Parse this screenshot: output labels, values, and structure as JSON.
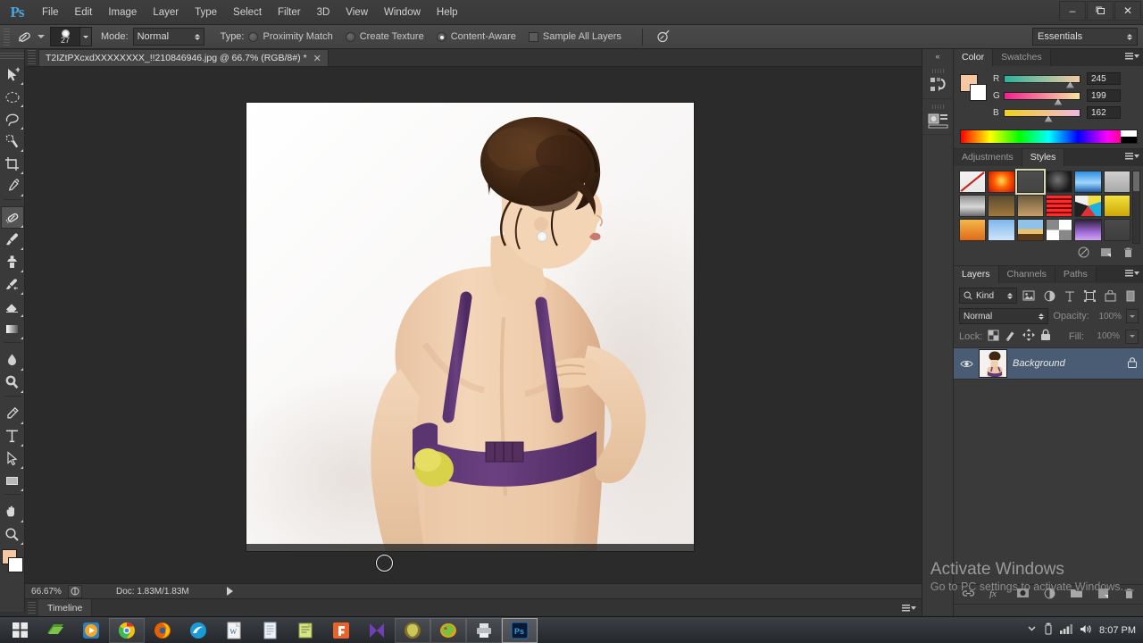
{
  "app": {
    "name": "Adobe Photoshop",
    "logo_text": "Ps",
    "workspace": "Essentials"
  },
  "menubar": {
    "items": [
      {
        "label": "File"
      },
      {
        "label": "Edit"
      },
      {
        "label": "Image"
      },
      {
        "label": "Layer"
      },
      {
        "label": "Type"
      },
      {
        "label": "Select"
      },
      {
        "label": "Filter"
      },
      {
        "label": "3D"
      },
      {
        "label": "View"
      },
      {
        "label": "Window"
      },
      {
        "label": "Help"
      }
    ],
    "window_controls": {
      "minimize": "–",
      "restore": "❐",
      "close": "✕"
    }
  },
  "options_bar": {
    "tool_icon": "spot-healing-brush-icon",
    "brush_size": "27",
    "mode_label": "Mode:",
    "mode_value": "Normal",
    "type_label": "Type:",
    "type_options": [
      {
        "label": "Proximity Match",
        "selected": false
      },
      {
        "label": "Create Texture",
        "selected": false
      },
      {
        "label": "Content-Aware",
        "selected": true
      }
    ],
    "sample_all_layers": {
      "label": "Sample All Layers",
      "checked": false
    },
    "pressure_icon": "tablet-pressure-icon"
  },
  "toolbar": {
    "tools": [
      {
        "name": "move-tool",
        "selected": false
      },
      {
        "name": "marquee-tool",
        "selected": false
      },
      {
        "name": "lasso-tool",
        "selected": false
      },
      {
        "name": "quick-selection-tool",
        "selected": false
      },
      {
        "name": "crop-tool",
        "selected": false
      },
      {
        "name": "eyedropper-tool",
        "selected": false
      },
      {
        "name": "spot-healing-brush-tool",
        "selected": true
      },
      {
        "name": "brush-tool",
        "selected": false
      },
      {
        "name": "clone-stamp-tool",
        "selected": false
      },
      {
        "name": "history-brush-tool",
        "selected": false
      },
      {
        "name": "eraser-tool",
        "selected": false
      },
      {
        "name": "gradient-tool",
        "selected": false
      },
      {
        "name": "blur-tool",
        "selected": false
      },
      {
        "name": "dodge-tool",
        "selected": false
      },
      {
        "name": "pen-tool",
        "selected": false
      },
      {
        "name": "type-tool",
        "selected": false
      },
      {
        "name": "path-selection-tool",
        "selected": false
      },
      {
        "name": "rectangle-tool",
        "selected": false
      },
      {
        "name": "hand-tool",
        "selected": false
      },
      {
        "name": "zoom-tool",
        "selected": false
      }
    ],
    "foreground_color": "#f5c7a2",
    "background_color": "#ffffff"
  },
  "document": {
    "tab_title": "T2IZtPXcxdXXXXXXXX_!!210846946.jpg @ 66.7% (RGB/8#) *",
    "close_glyph": "✕"
  },
  "statusbar": {
    "zoom": "66.67%",
    "doc_info": "Doc: 1.83M/1.83M"
  },
  "timeline": {
    "tab_label": "Timeline"
  },
  "mini_dock": {
    "collapse_glyph": "«",
    "items": [
      {
        "name": "history-panel-icon"
      },
      {
        "name": "properties-panel-icon"
      }
    ]
  },
  "color_panel": {
    "tabs": [
      {
        "label": "Color",
        "active": true
      },
      {
        "label": "Swatches",
        "active": false
      }
    ],
    "channels": [
      {
        "label": "R",
        "value": "245",
        "pos": 82
      },
      {
        "label": "G",
        "value": "199",
        "pos": 66
      },
      {
        "label": "B",
        "value": "162",
        "pos": 53
      }
    ],
    "foreground": "#f5c7a2",
    "background": "#ffffff"
  },
  "styles_panel": {
    "tabs": [
      {
        "label": "Adjustments",
        "active": false
      },
      {
        "label": "Styles",
        "active": true
      }
    ],
    "swatches": [
      {
        "name": "none-style",
        "css": "linear-gradient(#f2f2f2,#e8e8e8)",
        "selected": false
      },
      {
        "name": "red-glow-style",
        "css": "radial-gradient(circle at 50% 45%, #ffd24a 5%, #ff5a00 45%, #c01000 100%)",
        "selected": false
      },
      {
        "name": "bevel-outline-style",
        "css": "linear-gradient(#4d4d4d,#444)",
        "selected": true
      },
      {
        "name": "dark-swirl-style",
        "css": "radial-gradient(circle at 45% 40%, #6e6e6e 5%, #1a1a1a 70%)",
        "selected": false
      },
      {
        "name": "blue-gel-style",
        "css": "linear-gradient(#2f8de0,#9fd8ff 55%, #1d5fa8)",
        "selected": false
      },
      {
        "name": "grey-button-style",
        "css": "linear-gradient(#d0d0d0,#a8a8a8)",
        "selected": false
      },
      {
        "name": "chrome-step-style",
        "css": "linear-gradient(#8d8d8d,#d8d8d8 55%,#6a6a6a)",
        "selected": false
      },
      {
        "name": "brown-gradient-style",
        "css": "linear-gradient(#5a4a30,#a07a3c)",
        "selected": false
      },
      {
        "name": "tan-gradient-style",
        "css": "linear-gradient(#6b5a3e,#c8a068)",
        "selected": false
      },
      {
        "name": "red-stripes-style",
        "css": "repeating-linear-gradient(#ff2b2b 0 3px,#7a0000 3px 5px)",
        "selected": false
      },
      {
        "name": "confetti-style",
        "css": "conic-gradient(#f0e040 0 20%, #20b0e0 20% 40%, #e03030 40% 60%, #202020 60% 80%, #f0f0f0 80% 100%)",
        "selected": false
      },
      {
        "name": "yellow-box-style",
        "css": "linear-gradient(#f4e13a,#caa808)",
        "selected": false
      },
      {
        "name": "orange-sunset-style",
        "css": "linear-gradient(#f3b84a,#e06a18)",
        "selected": false
      },
      {
        "name": "blue-sky-style",
        "css": "linear-gradient(#7fb6ea,#cfe6fb)",
        "selected": false
      },
      {
        "name": "horizon-style",
        "css": "linear-gradient(#8fc2e8 0 45%, #e8c070 45% 70%, #5a3a18 70%)",
        "selected": false
      },
      {
        "name": "noise-texture-style",
        "css": "repeating-conic-gradient(#ffffff 0 25%, #888888 0 50%)",
        "selected": false
      },
      {
        "name": "violet-gel-style",
        "css": "linear-gradient(#2e2038,#a06ad8 60%, #cfa8f0)",
        "selected": false
      },
      {
        "name": "plain-grey-style",
        "css": "linear-gradient(#4a4a4a,#3e3e3e)",
        "selected": false
      }
    ],
    "footer_icons": [
      {
        "name": "clear-style-icon"
      },
      {
        "name": "new-style-icon"
      },
      {
        "name": "delete-style-icon"
      }
    ]
  },
  "layers_panel": {
    "tabs": [
      {
        "label": "Layers",
        "active": true
      },
      {
        "label": "Channels",
        "active": false
      },
      {
        "label": "Paths",
        "active": false
      }
    ],
    "filter": {
      "kind_label": "Kind",
      "icons": [
        {
          "name": "filter-pixel-icon"
        },
        {
          "name": "filter-adjustment-icon"
        },
        {
          "name": "filter-type-icon"
        },
        {
          "name": "filter-shape-icon"
        },
        {
          "name": "filter-smartobject-icon"
        },
        {
          "name": "filter-toggle-icon"
        }
      ]
    },
    "blend_mode": "Normal",
    "opacity_label": "Opacity:",
    "opacity_value": "100%",
    "lock_label": "Lock:",
    "lock_icons": [
      {
        "name": "lock-transparency-icon"
      },
      {
        "name": "lock-image-icon"
      },
      {
        "name": "lock-position-icon"
      },
      {
        "name": "lock-all-icon"
      }
    ],
    "fill_label": "Fill:",
    "fill_value": "100%",
    "layers": [
      {
        "name": "Background",
        "visible": true,
        "locked": true,
        "selected": true
      }
    ],
    "footer_icons": [
      {
        "name": "link-layers-icon"
      },
      {
        "name": "layer-style-fx-icon"
      },
      {
        "name": "add-layer-mask-icon"
      },
      {
        "name": "new-adjustment-layer-icon"
      },
      {
        "name": "new-group-icon"
      },
      {
        "name": "new-layer-icon"
      },
      {
        "name": "delete-layer-icon"
      }
    ]
  },
  "watermark": {
    "title": "Activate Windows",
    "subtitle": "Go to PC settings to activate Windows."
  },
  "taskbar": {
    "start_icon": "windows-start-icon",
    "apps": [
      {
        "name": "taskbar-explorer-icon",
        "state": "pinned"
      },
      {
        "name": "taskbar-media-player-icon",
        "state": "pinned"
      },
      {
        "name": "taskbar-chrome-icon",
        "state": "running"
      },
      {
        "name": "taskbar-firefox-icon",
        "state": "pinned"
      },
      {
        "name": "taskbar-dreamweaver-icon",
        "state": "pinned"
      },
      {
        "name": "taskbar-word-icon",
        "state": "pinned"
      },
      {
        "name": "taskbar-notepad-icon",
        "state": "pinned"
      },
      {
        "name": "taskbar-notes-icon",
        "state": "pinned"
      },
      {
        "name": "taskbar-flash-icon",
        "state": "pinned"
      },
      {
        "name": "taskbar-mail-icon",
        "state": "pinned"
      },
      {
        "name": "taskbar-viber-icon",
        "state": "running"
      },
      {
        "name": "taskbar-paint-icon",
        "state": "running"
      },
      {
        "name": "taskbar-printer-icon",
        "state": "running"
      },
      {
        "name": "taskbar-photoshop-icon",
        "state": "active"
      }
    ],
    "tray": {
      "icons": [
        {
          "name": "tray-show-hidden-icon"
        },
        {
          "name": "tray-usb-icon"
        },
        {
          "name": "tray-network-icon"
        },
        {
          "name": "tray-volume-icon"
        }
      ],
      "clock": "8:07 PM"
    }
  },
  "canvas": {
    "image_alt": "photo-woman-back-purple-bra",
    "cursor": "brush-circle-cursor"
  }
}
